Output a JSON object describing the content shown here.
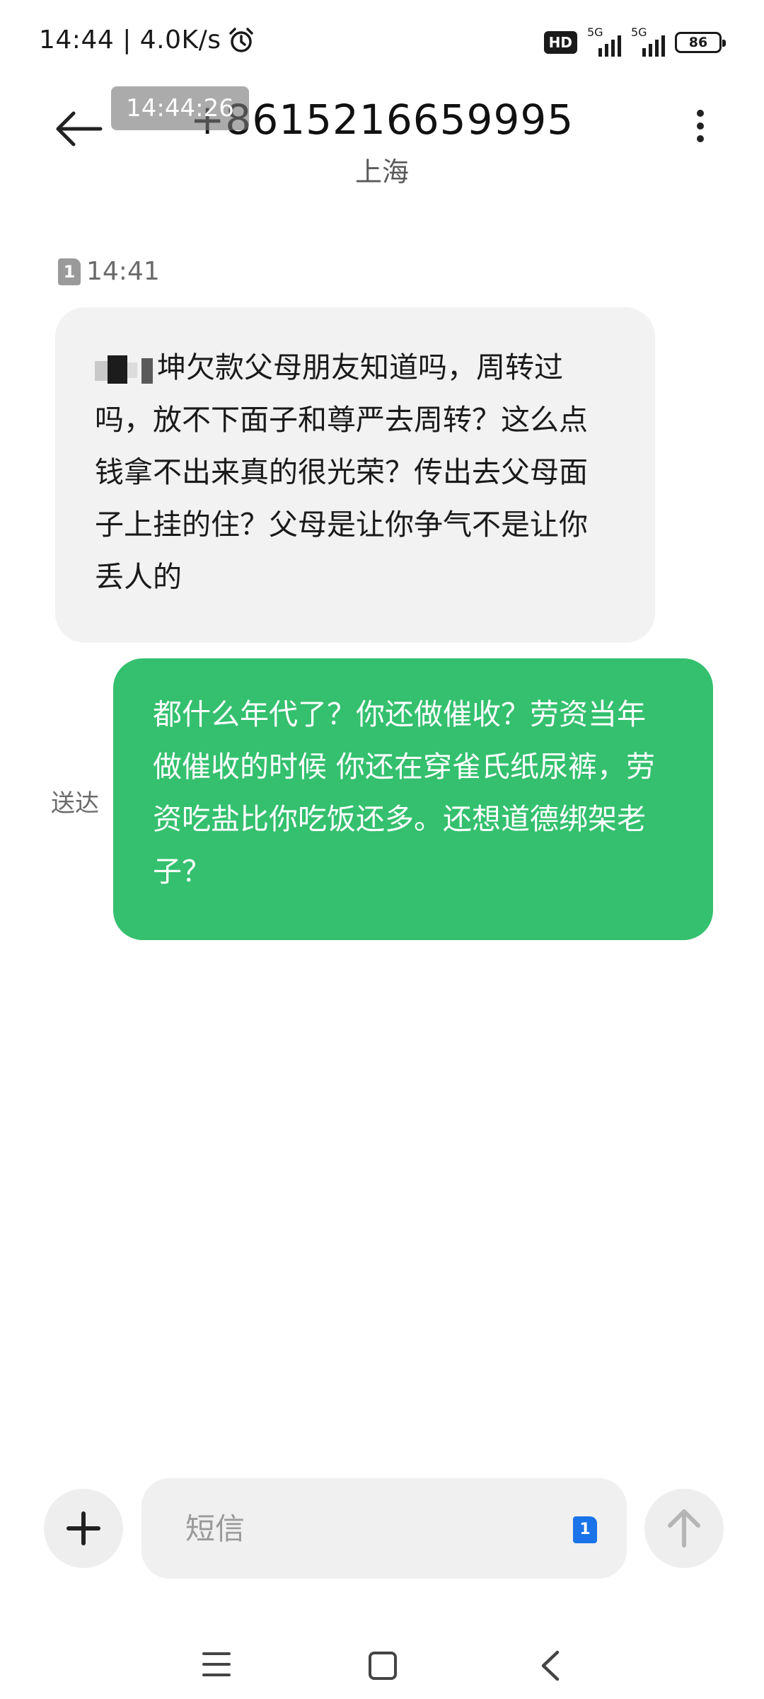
{
  "status_bar": {
    "time_speed": "14:44 | 4.0K/s",
    "hd_label": "HD",
    "network_1": "5G",
    "network_2": "5G",
    "battery": "86"
  },
  "header": {
    "time_overlay": "14:44:26",
    "phone_number": "+8615216659995",
    "location": "上海"
  },
  "thread": {
    "incoming": {
      "sim_slot": "1",
      "time": "14:41",
      "text": "坤欠款父母朋友知道吗，周转过吗，放不下面子和尊严去周转？这么点钱拿不出来真的很光荣？传出去父母面子上挂的住？父母是让你争气不是让你丢人的"
    },
    "outgoing": {
      "status": "送达",
      "text": "都什么年代了？你还做催收？劳资当年做催收的时候 你还在穿雀氏纸尿裤，劳资吃盐比你吃饭还多。还想道德绑架老子？"
    }
  },
  "composer": {
    "placeholder": "短信",
    "sim_slot": "1"
  },
  "colors": {
    "outgoing_bubble": "#34c06e",
    "incoming_bubble": "#f2f2f2",
    "sim_selector": "#1a73e8"
  },
  "icons": [
    "back-arrow-icon",
    "more-vertical-icon",
    "alarm-clock-icon",
    "plus-icon",
    "send-arrow-icon",
    "nav-menu-icon",
    "nav-home-icon",
    "nav-back-icon"
  ]
}
